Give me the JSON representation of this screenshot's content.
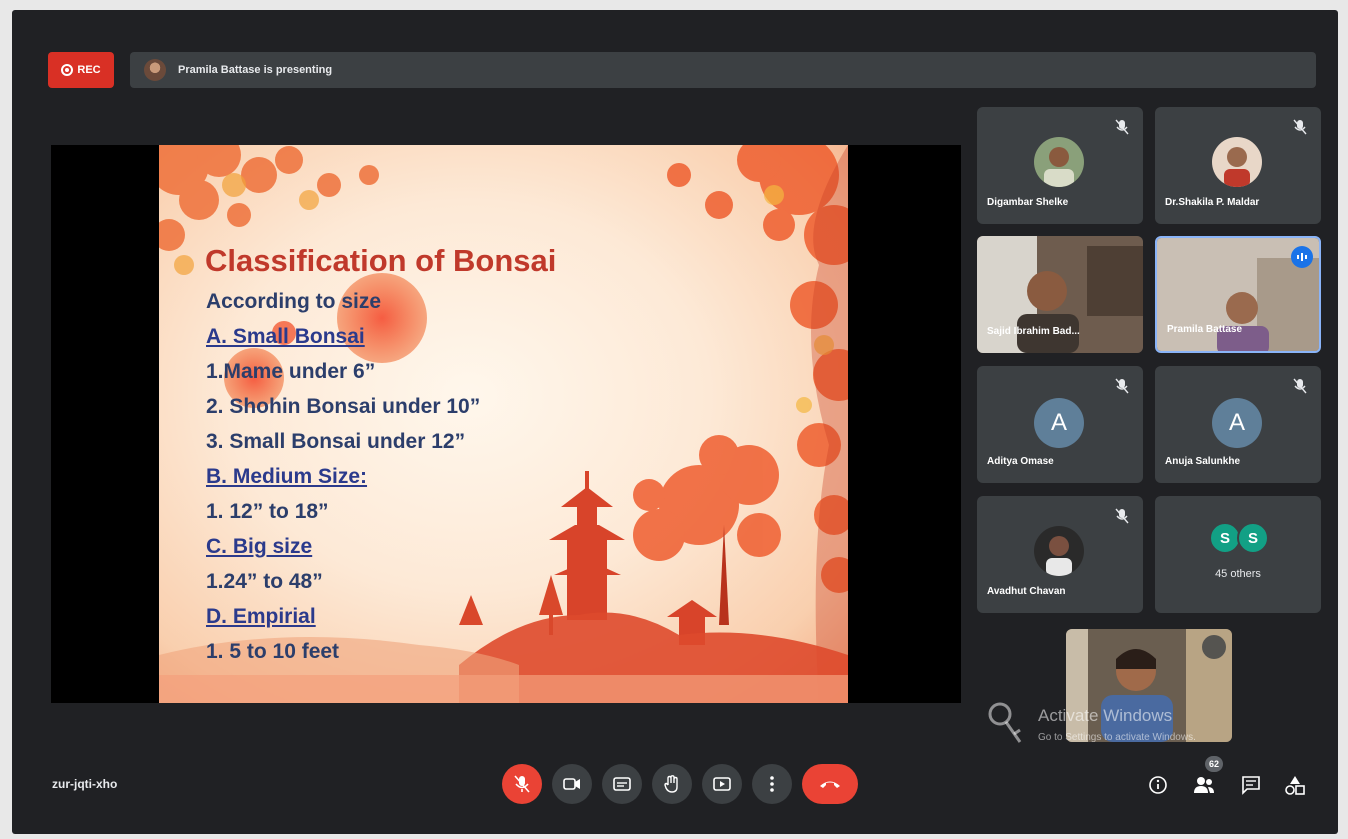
{
  "topbar": {
    "rec_label": "REC",
    "presenting_text": "Pramila Battase is presenting"
  },
  "slide": {
    "title": "Classification of Bonsai",
    "lines": [
      "According to size",
      "A. Small Bonsai",
      "1.Mame  under 6”",
      "2. Shohin Bonsai under 10”",
      "3. Small Bonsai under 12”",
      "B. Medium Size:",
      "1. 12” to 18”",
      "C. Big size",
      "1.24” to 48”",
      "D. Empirial",
      "1. 5 to 10 feet"
    ]
  },
  "participants": [
    {
      "name": "Digambar Shelke",
      "avatar": "photo",
      "muted": true
    },
    {
      "name": "Dr.Shakila P. Maldar",
      "avatar": "photo",
      "muted": true
    },
    {
      "name": "Sajid Ibrahim Bad...",
      "avatar": "video",
      "muted": false
    },
    {
      "name": "Pramila Battase",
      "avatar": "video",
      "muted": false,
      "speaking": true
    },
    {
      "name": "Aditya Omase",
      "avatar": "A",
      "muted": true
    },
    {
      "name": "Anuja Salunkhe",
      "avatar": "A",
      "muted": true
    },
    {
      "name": "Avadhut Chavan",
      "avatar": "photo",
      "muted": true
    }
  ],
  "others": {
    "initials": [
      "S",
      "S"
    ],
    "label": "45 others"
  },
  "watermark": {
    "title": "Activate Windows",
    "subtitle": "Go to Settings to activate Windows."
  },
  "footer": {
    "meeting_code": "zur-jqti-xho",
    "participant_count": "62",
    "controls": [
      "mic-off",
      "camera",
      "captions",
      "raise-hand",
      "present",
      "more-options",
      "leave-call"
    ],
    "right_controls": [
      "meeting-details",
      "people",
      "chat",
      "activities"
    ]
  },
  "colors": {
    "background": "#202124",
    "tile": "#3c4043",
    "red": "#ea4335",
    "accent": "#8ab4f8",
    "title_red": "#c0392b",
    "slide_text": "#2c3e6b"
  }
}
